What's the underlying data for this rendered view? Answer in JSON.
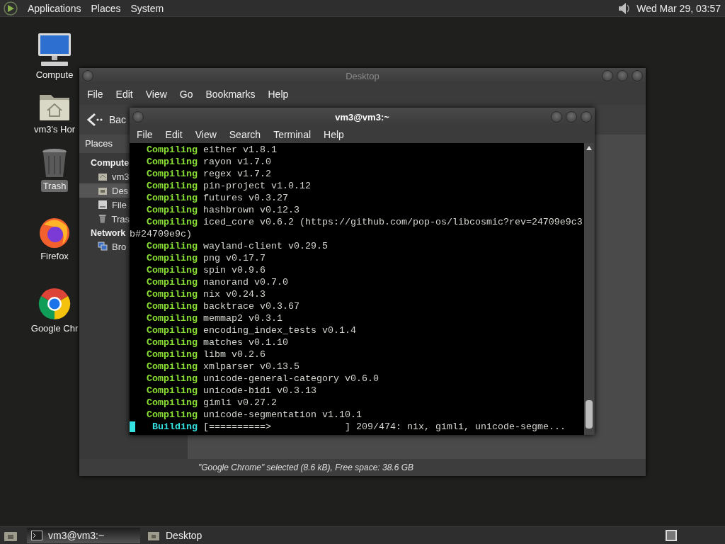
{
  "top_panel": {
    "menus": [
      "Applications",
      "Places",
      "System"
    ],
    "clock": "Wed Mar 29, 03:57"
  },
  "desktop_icons": [
    {
      "kind": "computer",
      "label": "Compute",
      "selected": false
    },
    {
      "kind": "home",
      "label": "vm3's Hor",
      "selected": false
    },
    {
      "kind": "trash",
      "label": "Trash",
      "selected": true
    },
    {
      "kind": "firefox",
      "label": "Firefox",
      "selected": false
    },
    {
      "kind": "chrome",
      "label": "Google Chr",
      "selected": false
    }
  ],
  "file_manager": {
    "title": "Desktop",
    "menu": [
      "File",
      "Edit",
      "View",
      "Go",
      "Bookmarks",
      "Help"
    ],
    "back_button": "Bac",
    "places_header": "Places",
    "sidebar": [
      {
        "kind": "heading",
        "label": "Compute"
      },
      {
        "kind": "home",
        "label": "vm3",
        "selected": false
      },
      {
        "kind": "desktop",
        "label": "Des",
        "selected": true
      },
      {
        "kind": "drive",
        "label": "File",
        "selected": false
      },
      {
        "kind": "trash",
        "label": "Tras",
        "selected": false
      },
      {
        "kind": "heading",
        "label": "Network"
      },
      {
        "kind": "network",
        "label": "Bro",
        "selected": false
      }
    ],
    "status": "\"Google Chrome\" selected (8.6 kB), Free space: 38.6 GB"
  },
  "terminal": {
    "title": "vm3@vm3:~",
    "menu": [
      "File",
      "Edit",
      "View",
      "Search",
      "Terminal",
      "Help"
    ],
    "lines": [
      {
        "kind": "compiling",
        "label": "Compiling",
        "text": "either v1.8.1"
      },
      {
        "kind": "compiling",
        "label": "Compiling",
        "text": "rayon v1.7.0"
      },
      {
        "kind": "compiling",
        "label": "Compiling",
        "text": "regex v1.7.2"
      },
      {
        "kind": "compiling",
        "label": "Compiling",
        "text": "pin-project v1.0.12"
      },
      {
        "kind": "compiling",
        "label": "Compiling",
        "text": "futures v0.3.27"
      },
      {
        "kind": "compiling",
        "label": "Compiling",
        "text": "hashbrown v0.12.3"
      },
      {
        "kind": "compiling",
        "label": "Compiling",
        "text": "iced_core v0.6.2 (https://github.com/pop-os/libcosmic?rev=24709e9c3"
      },
      {
        "kind": "continuation",
        "text": "b#24709e9c)"
      },
      {
        "kind": "compiling",
        "label": "Compiling",
        "text": "wayland-client v0.29.5"
      },
      {
        "kind": "compiling",
        "label": "Compiling",
        "text": "png v0.17.7"
      },
      {
        "kind": "compiling",
        "label": "Compiling",
        "text": "spin v0.9.6"
      },
      {
        "kind": "compiling",
        "label": "Compiling",
        "text": "nanorand v0.7.0"
      },
      {
        "kind": "compiling",
        "label": "Compiling",
        "text": "nix v0.24.3"
      },
      {
        "kind": "compiling",
        "label": "Compiling",
        "text": "backtrace v0.3.67"
      },
      {
        "kind": "compiling",
        "label": "Compiling",
        "text": "memmap2 v0.3.1"
      },
      {
        "kind": "compiling",
        "label": "Compiling",
        "text": "encoding_index_tests v0.1.4"
      },
      {
        "kind": "compiling",
        "label": "Compiling",
        "text": "matches v0.1.10"
      },
      {
        "kind": "compiling",
        "label": "Compiling",
        "text": "libm v0.2.6"
      },
      {
        "kind": "compiling",
        "label": "Compiling",
        "text": "xmlparser v0.13.5"
      },
      {
        "kind": "compiling",
        "label": "Compiling",
        "text": "unicode-general-category v0.6.0"
      },
      {
        "kind": "compiling",
        "label": "Compiling",
        "text": "unicode-bidi v0.3.13"
      },
      {
        "kind": "compiling",
        "label": "Compiling",
        "text": "gimli v0.27.2"
      },
      {
        "kind": "compiling",
        "label": "Compiling",
        "text": "unicode-segmentation v1.10.1"
      },
      {
        "kind": "building",
        "label": "Building",
        "bar": "[==========>             ]",
        "text": "209/474: nix, gimli, unicode-segme..."
      }
    ]
  },
  "taskbar": {
    "tasks": [
      {
        "kind": "terminal",
        "label": "vm3@vm3:~",
        "selected": true
      },
      {
        "kind": "folder",
        "label": "Desktop",
        "selected": false
      }
    ]
  }
}
